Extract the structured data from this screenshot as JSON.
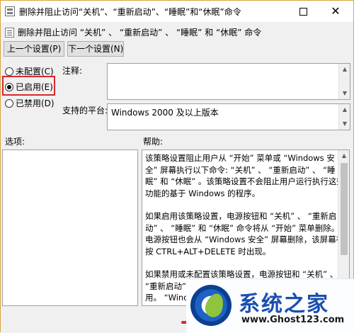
{
  "window": {
    "title": "删除并阻止访问“关机”、“重新启动”、“睡眠”和“休眠”命令",
    "maximize_symbol": "",
    "close_symbol": "✕"
  },
  "policy": {
    "name": "删除并阻止访问 “关机” 、 “重新启动” 、 “睡眠” 和 “休眠” 命令"
  },
  "buttons": {
    "prev": "上一个设置(P)",
    "next": "下一个设置(N)"
  },
  "radios": [
    {
      "label": "未配置(C)",
      "selected": false
    },
    {
      "label": "已启用(E)",
      "selected": true
    },
    {
      "label": "已禁用(D)",
      "selected": false
    }
  ],
  "labels": {
    "comment": "注释:",
    "platform": "支持的平台:",
    "options": "选项:",
    "help": "帮助:"
  },
  "fields": {
    "comment_value": "",
    "platform_value": "Windows 2000 及以上版本"
  },
  "help_text": [
    "该策略设置阻止用户从 “开始” 菜单或 “Windows 安全” 屏幕执行以下命令: “关机” 、 “重新启动” 、 “睡眠” 和 “休眠” 。该策略设置不会阻止用户运行执行这些功能的基于 Windows 的程序。",
    "如果启用该策略设置，电源按钮和 “关机” 、 “重新启动” 、 “睡眠” 和 “休眠” 命令将从 “开始” 菜单删除。电源按钮也会从 “Windows 安全” 屏幕删除，该屏幕在按 CTRL+ALT+DELETE 时出现。",
    "如果禁用或未配置该策略设置，电源按钮和 “关机” 、 “重新启动” 、 “睡眠” 和 “休眠” 命令在 “开始” 菜单可用。 “Windows 安全” 屏幕上的电源按钮也可用。"
  ],
  "watermark": {
    "title": "系统之家",
    "url": "www.Ghost123.com"
  },
  "colors": {
    "highlight": "#d8282e",
    "window_border": "#d9a441"
  }
}
